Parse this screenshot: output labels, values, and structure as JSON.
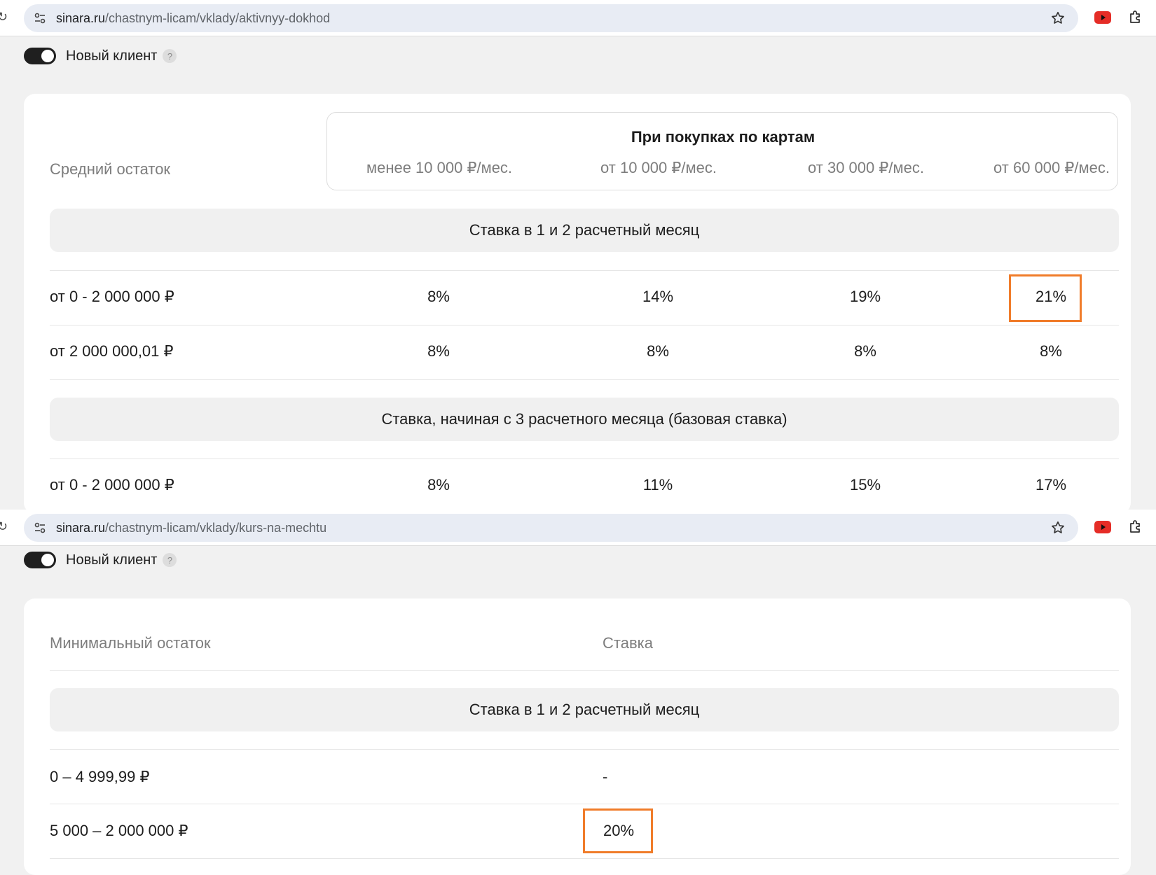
{
  "screen1": {
    "url_host": "sinara.ru",
    "url_path": "/chastnym-licam/vklady/aktivnyy-dokhod",
    "toggle_label": "Новый клиент",
    "help": "?",
    "header_left": "Средний остаток",
    "purchases_title": "При покупках по картам",
    "columns": [
      "менее 10 000 ₽/мес.",
      "от 10 000 ₽/мес.",
      "от 30 000 ₽/мес.",
      "от 60 000 ₽/мес."
    ],
    "section1": "Ставка в 1 и 2 расчетный месяц",
    "rows1": [
      {
        "label": "от 0 - 2 000 000 ₽",
        "values": [
          "8%",
          "14%",
          "19%",
          "21%"
        ]
      },
      {
        "label": "от 2 000 000,01 ₽",
        "values": [
          "8%",
          "8%",
          "8%",
          "8%"
        ]
      }
    ],
    "section2": "Ставка, начиная с 3 расчетного месяца (базовая ставка)",
    "rows2": [
      {
        "label": "от 0 - 2 000 000 ₽",
        "values": [
          "8%",
          "11%",
          "15%",
          "17%"
        ]
      }
    ]
  },
  "screen2": {
    "url_host": "sinara.ru",
    "url_path": "/chastnym-licam/vklady/kurs-na-mechtu",
    "toggle_label": "Новый клиент",
    "help": "?",
    "header_left": "Минимальный остаток",
    "header_right": "Ставка",
    "section1": "Ставка в 1 и 2 расчетный месяц",
    "rows": [
      {
        "label": "0 – 4 999,99 ₽",
        "value": "-"
      },
      {
        "label": "5 000 – 2 000 000 ₽",
        "value": "20%"
      }
    ]
  },
  "colors": {
    "highlight": "#f07c2a",
    "toggle": "#1f1f1f",
    "band": "#f0f0f0"
  },
  "icons": [
    "reload-icon",
    "site-settings-icon",
    "bookmark-star-icon",
    "youtube-icon",
    "extensions-icon",
    "help-icon"
  ]
}
